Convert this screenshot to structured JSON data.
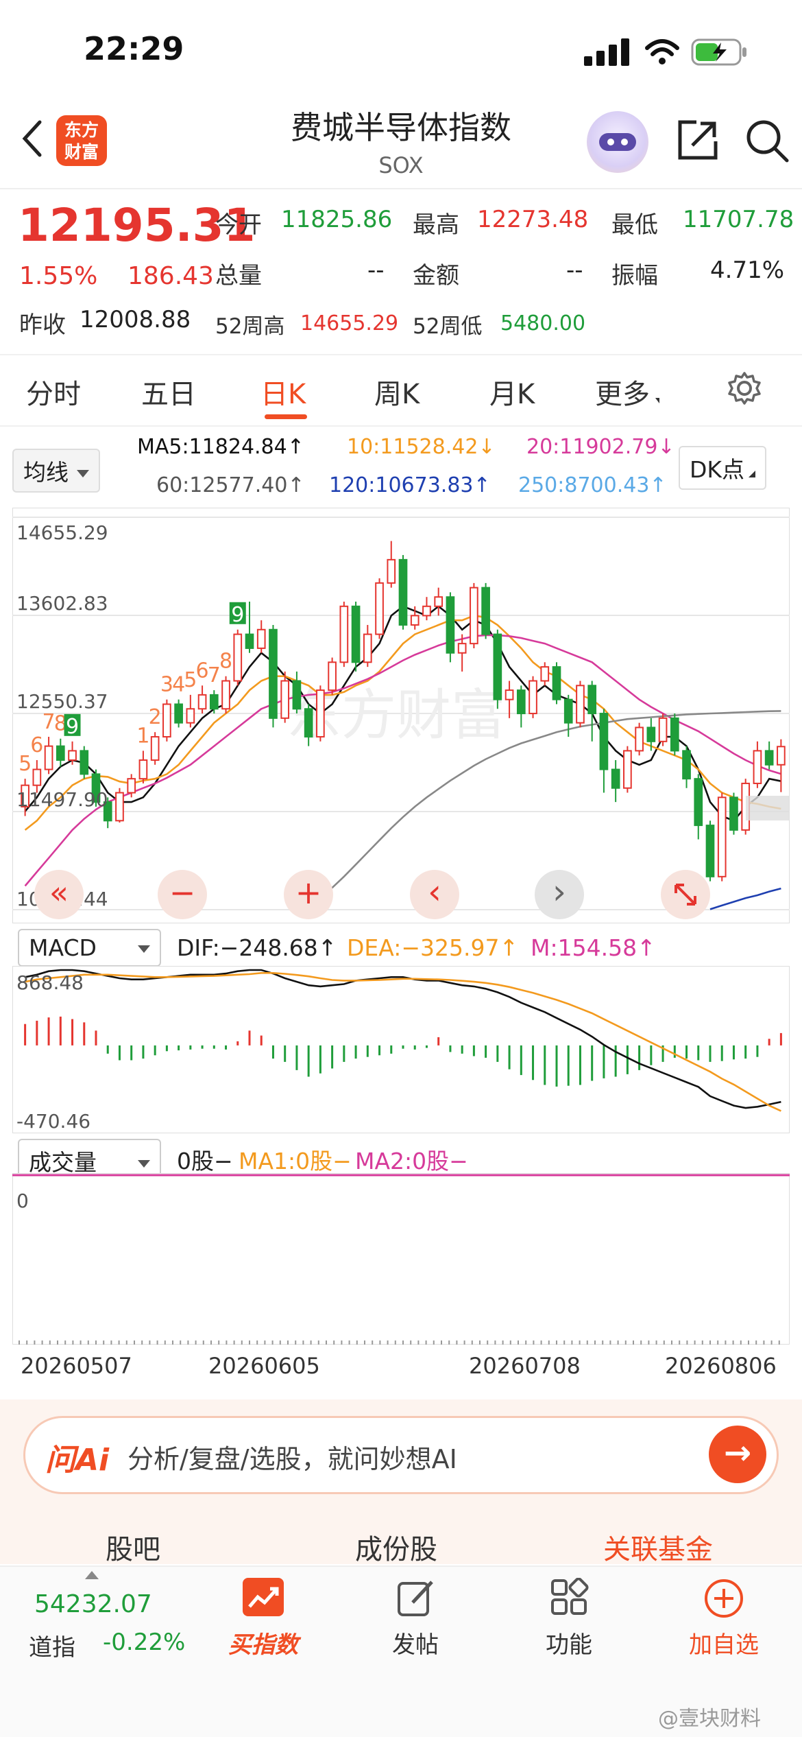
{
  "status": {
    "time": "22:29"
  },
  "header": {
    "logo_line1": "东方",
    "logo_line2": "财富",
    "title": "费城半导体指数",
    "subtitle": "SOX"
  },
  "quote": {
    "price": "12195.31",
    "pct": "1.55%",
    "change": "186.43",
    "open_label": "今开",
    "open": "11825.86",
    "high_label": "最高",
    "high": "12273.48",
    "low_label": "最低",
    "low": "11707.78",
    "volume_label": "总量",
    "volume": "--",
    "amount_label": "金额",
    "amount": "--",
    "amplitude_label": "振幅",
    "amplitude": "4.71%",
    "prev_close_label": "昨收",
    "prev_close": "12008.88",
    "week52_high_label": "52周高",
    "week52_high": "14655.29",
    "week52_low_label": "52周低",
    "week52_low": "5480.00"
  },
  "tabs": [
    "分时",
    "五日",
    "日K",
    "周K",
    "月K",
    "更多"
  ],
  "ma": {
    "selector": "均线",
    "ma5": "MA5:11824.84↑",
    "ma10": "10:11528.42↓",
    "ma20": "20:11902.79↓",
    "ma60": "60:12577.40↑",
    "ma120": "120:10673.83↑",
    "ma250": "250:8700.43↑",
    "dk_button": "DK点",
    "colors": {
      "ma5": "#111111",
      "ma10": "#f39a1e",
      "ma20": "#d63a9a",
      "ma60": "#888888",
      "ma120": "#1e3fb0",
      "ma250": "#5aa9e6"
    }
  },
  "chart_data": [
    {
      "type": "candlestick",
      "y_ticks": [
        "14655.29",
        "13602.83",
        "12550.37",
        "11497.90",
        "10445.44"
      ],
      "ylim": [
        10445.44,
        14655.29
      ],
      "watermark": "东方财富",
      "td_labels": [
        "5",
        "6",
        "7",
        "8",
        "9",
        "1",
        "2",
        "3",
        "4",
        "5",
        "6",
        "7",
        "8",
        "9"
      ],
      "candles": [
        [
          11550,
          11780,
          11450,
          11850
        ],
        [
          11780,
          11950,
          11700,
          12050
        ],
        [
          11950,
          12200,
          11900,
          12300
        ],
        [
          12200,
          12050,
          11980,
          12280
        ],
        [
          12050,
          12150,
          12000,
          12250
        ],
        [
          12150,
          11900,
          11850,
          12200
        ],
        [
          11900,
          11600,
          11550,
          11950
        ],
        [
          11600,
          11400,
          11320,
          11650
        ],
        [
          11400,
          11700,
          11380,
          11750
        ],
        [
          11700,
          11850,
          11650,
          11900
        ],
        [
          11850,
          12050,
          11800,
          12150
        ],
        [
          12050,
          12300,
          12000,
          12350
        ],
        [
          12300,
          12650,
          12250,
          12700
        ],
        [
          12650,
          12450,
          12400,
          12700
        ],
        [
          12450,
          12600,
          12400,
          12750
        ],
        [
          12600,
          12750,
          12550,
          12850
        ],
        [
          12750,
          12600,
          12550,
          12800
        ],
        [
          12600,
          12900,
          12550,
          12950
        ],
        [
          12900,
          13400,
          12850,
          13450
        ],
        [
          13400,
          13250,
          13200,
          13750
        ],
        [
          13250,
          13450,
          13200,
          13550
        ],
        [
          13450,
          12500,
          12400,
          13500
        ],
        [
          12500,
          12900,
          12450,
          13000
        ],
        [
          12900,
          12600,
          12550,
          13000
        ],
        [
          12600,
          12300,
          12200,
          12650
        ],
        [
          12300,
          12800,
          12250,
          12850
        ],
        [
          12800,
          13100,
          12750,
          13150
        ],
        [
          13100,
          13700,
          13050,
          13750
        ],
        [
          13700,
          13100,
          13000,
          13750
        ],
        [
          13100,
          13400,
          13050,
          13500
        ],
        [
          13400,
          13950,
          13350,
          14000
        ],
        [
          13950,
          14200,
          13900,
          14400
        ],
        [
          14200,
          13500,
          13450,
          14250
        ],
        [
          13500,
          13600,
          13450,
          13700
        ],
        [
          13600,
          13700,
          13550,
          13800
        ],
        [
          13700,
          13800,
          13600,
          13900
        ],
        [
          13800,
          13200,
          13100,
          13850
        ],
        [
          13200,
          13300,
          13000,
          13400
        ],
        [
          13300,
          13900,
          13250,
          13950
        ],
        [
          13900,
          13400,
          13350,
          13950
        ],
        [
          13400,
          12700,
          12600,
          13450
        ],
        [
          12700,
          12800,
          12500,
          12900
        ],
        [
          12800,
          12550,
          12400,
          12850
        ],
        [
          12550,
          12900,
          12500,
          12950
        ],
        [
          12900,
          13050,
          12850,
          13100
        ],
        [
          13050,
          12700,
          12650,
          13100
        ],
        [
          12700,
          12450,
          12300,
          12750
        ],
        [
          12450,
          12850,
          12400,
          12900
        ],
        [
          12850,
          12550,
          12250,
          12900
        ],
        [
          12550,
          11950,
          11700,
          12600
        ],
        [
          11950,
          11750,
          11600,
          12050
        ],
        [
          11750,
          12150,
          11700,
          12200
        ],
        [
          12150,
          12400,
          12100,
          12450
        ],
        [
          12400,
          12250,
          12150,
          12500
        ],
        [
          12250,
          12500,
          12200,
          12550
        ],
        [
          12500,
          12150,
          12100,
          12550
        ],
        [
          12150,
          11850,
          11750,
          12200
        ],
        [
          11850,
          11350,
          11200,
          11900
        ],
        [
          11350,
          10800,
          10750,
          11400
        ],
        [
          10800,
          11650,
          10750,
          11700
        ],
        [
          11650,
          11300,
          11250,
          11700
        ],
        [
          11300,
          11800,
          11250,
          11850
        ],
        [
          11800,
          12150,
          11750,
          12250
        ],
        [
          12150,
          12000,
          11950,
          12250
        ],
        [
          12000,
          12195,
          11707,
          12273
        ]
      ],
      "series": [
        {
          "name": "MA5",
          "values": [
            11500,
            11650,
            11850,
            11980,
            12050,
            12020,
            11900,
            11700,
            11600,
            11600,
            11650,
            11800,
            12000,
            12200,
            12350,
            12500,
            12600,
            12650,
            12850,
            13050,
            13200,
            13100,
            12950,
            12850,
            12650,
            12550,
            12650,
            12850,
            13050,
            13150,
            13300,
            13600,
            13700,
            13650,
            13600,
            13700,
            13600,
            13450,
            13550,
            13500,
            13300,
            13050,
            12900,
            12750,
            12850,
            12750,
            12700,
            12650,
            12550,
            12300,
            12150,
            12050,
            12000,
            12050,
            12300,
            12300,
            12200,
            11950,
            11600,
            11450,
            11400,
            11550,
            11650,
            11850,
            11824
          ]
        },
        {
          "name": "10",
          "values": [
            11300,
            11400,
            11550,
            11650,
            11780,
            11850,
            11880,
            11870,
            11820,
            11800,
            11830,
            11850,
            11900,
            12000,
            12150,
            12300,
            12450,
            12550,
            12650,
            12800,
            12900,
            12950,
            12950,
            12900,
            12850,
            12750,
            12750,
            12780,
            12850,
            12900,
            13000,
            13150,
            13300,
            13400,
            13450,
            13500,
            13550,
            13550,
            13600,
            13580,
            13500,
            13380,
            13250,
            13100,
            13000,
            12950,
            12850,
            12750,
            12700,
            12600,
            12450,
            12350,
            12250,
            12200,
            12150,
            12100,
            12050,
            11950,
            11800,
            11700,
            11650,
            11600,
            11580,
            11550,
            11528
          ]
        },
        {
          "name": "20",
          "values": [
            10700,
            10850,
            11000,
            11150,
            11300,
            11420,
            11520,
            11600,
            11650,
            11700,
            11750,
            11800,
            11860,
            11930,
            12000,
            12100,
            12200,
            12300,
            12400,
            12500,
            12600,
            12650,
            12700,
            12730,
            12750,
            12760,
            12780,
            12820,
            12870,
            12920,
            12980,
            13050,
            13120,
            13180,
            13230,
            13280,
            13320,
            13350,
            13380,
            13390,
            13390,
            13380,
            13360,
            13330,
            13300,
            13250,
            13200,
            13150,
            13100,
            13000,
            12900,
            12800,
            12700,
            12620,
            12550,
            12480,
            12420,
            12360,
            12280,
            12200,
            12120,
            12050,
            11990,
            11940,
            11902
          ]
        },
        {
          "name": "60",
          "values": [
            null,
            null,
            null,
            null,
            null,
            null,
            null,
            null,
            null,
            null,
            null,
            null,
            null,
            null,
            null,
            null,
            null,
            null,
            null,
            null,
            null,
            null,
            null,
            null,
            10450,
            10560,
            10680,
            10800,
            10930,
            11060,
            11190,
            11320,
            11440,
            11550,
            11650,
            11740,
            11830,
            11910,
            11990,
            12060,
            12120,
            12180,
            12230,
            12270,
            12310,
            12350,
            12380,
            12410,
            12430,
            12450,
            12470,
            12490,
            12500,
            12510,
            12520,
            12530,
            12540,
            12545,
            12550,
            12555,
            12560,
            12565,
            12570,
            12575,
            12577
          ]
        },
        {
          "name": "120",
          "values": [
            null,
            null,
            null,
            null,
            null,
            null,
            null,
            null,
            null,
            null,
            null,
            null,
            null,
            null,
            null,
            null,
            null,
            null,
            null,
            null,
            null,
            null,
            null,
            null,
            null,
            null,
            null,
            null,
            null,
            null,
            null,
            null,
            null,
            null,
            null,
            null,
            null,
            null,
            null,
            null,
            null,
            null,
            null,
            null,
            null,
            null,
            null,
            null,
            null,
            null,
            null,
            null,
            null,
            null,
            null,
            null,
            null,
            null,
            10450,
            10490,
            10530,
            10570,
            10600,
            10640,
            10673
          ]
        }
      ]
    },
    {
      "type": "macd",
      "ylim": [
        -470.46,
        868.48
      ],
      "y_ticks": [
        "868.48",
        "-470.46"
      ],
      "dif": [
        820,
        840,
        870,
        880,
        880,
        870,
        850,
        830,
        810,
        800,
        800,
        810,
        820,
        830,
        840,
        840,
        840,
        850,
        870,
        880,
        880,
        850,
        810,
        780,
        750,
        740,
        750,
        760,
        790,
        800,
        810,
        820,
        820,
        800,
        790,
        790,
        770,
        750,
        740,
        720,
        690,
        650,
        600,
        560,
        520,
        470,
        420,
        370,
        310,
        240,
        180,
        130,
        80,
        40,
        0,
        -40,
        -80,
        -120,
        -200,
        -240,
        -280,
        -300,
        -290,
        -270,
        -248.68
      ],
      "dea": [
        780,
        800,
        810,
        820,
        830,
        840,
        840,
        840,
        835,
        830,
        825,
        820,
        820,
        822,
        825,
        828,
        830,
        835,
        840,
        845,
        855,
        855,
        848,
        838,
        826,
        810,
        795,
        790,
        790,
        792,
        795,
        800,
        805,
        805,
        802,
        800,
        795,
        788,
        780,
        770,
        755,
        735,
        710,
        685,
        655,
        625,
        590,
        550,
        510,
        460,
        410,
        360,
        310,
        260,
        210,
        160,
        110,
        60,
        10,
        -50,
        -100,
        -160,
        -220,
        -280,
        -325.97
      ],
      "hist": [
        260,
        300,
        340,
        350,
        320,
        280,
        180,
        -100,
        -180,
        -180,
        -160,
        -120,
        -70,
        -60,
        -50,
        -40,
        -40,
        -50,
        50,
        180,
        120,
        -160,
        -200,
        -300,
        -380,
        -340,
        -280,
        -200,
        -160,
        -140,
        -120,
        -100,
        -40,
        -50,
        -30,
        100,
        -80,
        -100,
        -130,
        -150,
        -200,
        -290,
        -360,
        -420,
        -480,
        -500,
        -490,
        -480,
        -430,
        -400,
        -380,
        -350,
        -300,
        -240,
        -200,
        -150,
        -160,
        -180,
        -200,
        -190,
        -170,
        -160,
        -140,
        80,
        150
      ]
    },
    {
      "type": "volume",
      "y_ticks": [
        "0"
      ],
      "x_ticks": [
        "20260507",
        "20260605",
        "20260708",
        "20260806"
      ]
    }
  ],
  "controls": {
    "fast_back": "«",
    "zoom_out": "−",
    "zoom_in": "+",
    "prev": "‹",
    "next": "›"
  },
  "macd_bar": {
    "selector": "MACD",
    "dif": "DIF:−248.68↑",
    "dea": "DEA:−325.97↑",
    "m": "M:154.58↑"
  },
  "volume_bar": {
    "selector": "成交量",
    "vol": "0股−",
    "ma1": "MA1:0股−",
    "ma2": "MA2:0股−"
  },
  "ai": {
    "label": "问Ai",
    "placeholder": "分析/复盘/选股，就问妙想AI"
  },
  "subtabs": [
    "股吧",
    "成份股",
    "关联基金"
  ],
  "bottom": {
    "index_value": "54232.07",
    "index_name": "道指",
    "index_pct": "-0.22%",
    "buy_label": "买指数",
    "post_label": "发帖",
    "func_label": "功能",
    "add_label": "加自选"
  },
  "watermark": "@壹块财料"
}
